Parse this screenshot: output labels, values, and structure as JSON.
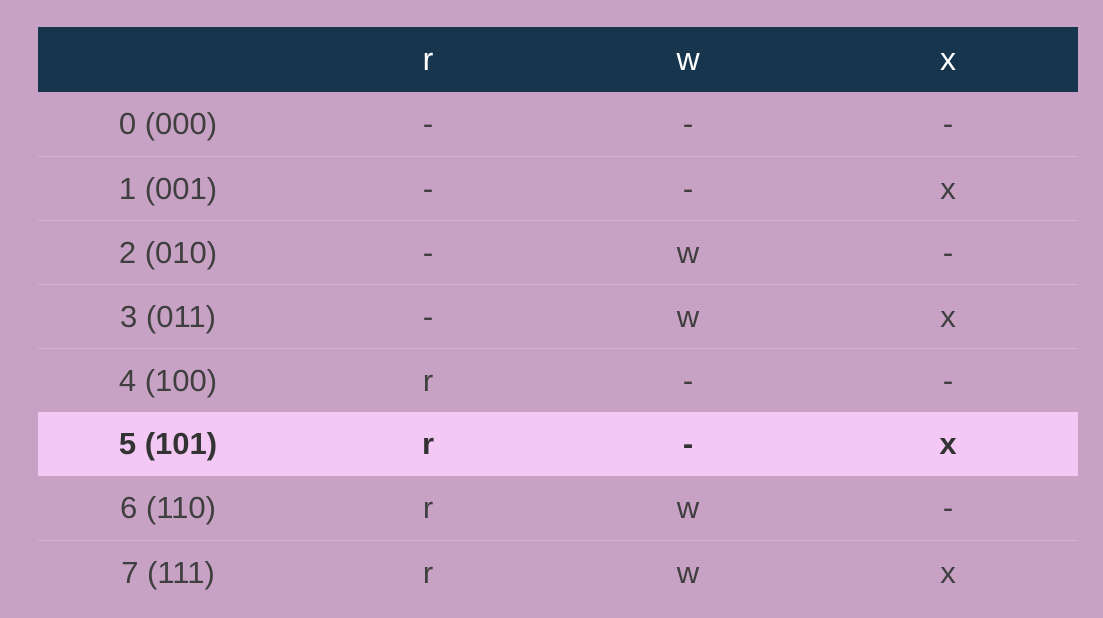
{
  "table": {
    "headers": [
      "",
      "r",
      "w",
      "x"
    ],
    "rows": [
      {
        "mode": "0 (000)",
        "r": "-",
        "w": "-",
        "x": "-"
      },
      {
        "mode": "1 (001)",
        "r": "-",
        "w": "-",
        "x": "x"
      },
      {
        "mode": "2 (010)",
        "r": "-",
        "w": "w",
        "x": "-"
      },
      {
        "mode": "3 (011)",
        "r": "-",
        "w": "w",
        "x": "x"
      },
      {
        "mode": "4 (100)",
        "r": "r",
        "w": "-",
        "x": "-"
      },
      {
        "mode": "5 (101)",
        "r": "r",
        "w": "-",
        "x": "x"
      },
      {
        "mode": "6 (110)",
        "r": "r",
        "w": "w",
        "x": "-"
      },
      {
        "mode": "7 (111)",
        "r": "r",
        "w": "w",
        "x": "x"
      }
    ],
    "highlighted_row_index": 5
  },
  "colors": {
    "background": "#c8a2c5",
    "header_background": "#17364d",
    "header_text": "#ffffff",
    "highlight_background": "#f4c8f4",
    "text": "#3f3f3f"
  }
}
